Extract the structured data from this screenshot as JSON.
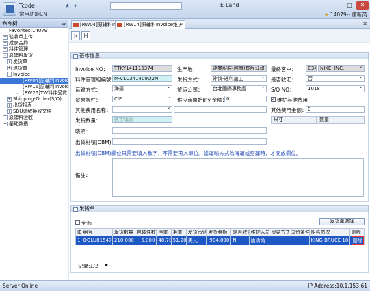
{
  "titlebar": {
    "app_title": "Tcode",
    "app_subtitle": "常用功能CN",
    "tcode_placeholder": "",
    "window_title": "E-Land",
    "user_info": "14079-- 唐昕芮"
  },
  "nav": {
    "header": "命令树",
    "items": [
      {
        "label": "Favorites:14079",
        "expander": "",
        "selected": false
      },
      {
        "label": "验收单上传",
        "expander": "+",
        "selected": false
      },
      {
        "label": "成衣合约",
        "expander": "+",
        "selected": false
      },
      {
        "label": "料件管理",
        "expander": "+",
        "selected": false
      },
      {
        "label": "原辅料发货",
        "expander": "-",
        "selected": false
      },
      {
        "label": "发货单",
        "expander": "+",
        "selected": false
      },
      {
        "label": "退货单",
        "expander": "+",
        "selected": false
      },
      {
        "label": "Invoice",
        "expander": "-",
        "selected": false
      },
      {
        "label": "[RW04]原辅料Invoice",
        "expander": "",
        "selected": true
      },
      {
        "label": "[RW16]原辅料Invoice查询",
        "expander": "",
        "selected": false
      },
      {
        "label": "[RW26]TW料件受貨單檢",
        "expander": "",
        "selected": false
      },
      {
        "label": "Shipping-Order(S/O)",
        "expander": "+",
        "selected": false
      },
      {
        "label": "出货报表",
        "expander": "+",
        "selected": false
      },
      {
        "label": "SBU请醒接收文件",
        "expander": "+",
        "selected": false
      },
      {
        "label": "原辅料验收",
        "expander": "+",
        "selected": false
      },
      {
        "label": "基础数据",
        "expander": "+",
        "selected": false
      }
    ]
  },
  "tabs": [
    {
      "label": "[RW04]原辅料Invoice",
      "active": false
    },
    {
      "label": "[RW14]原辅料Invoice维护",
      "active": true
    }
  ],
  "toolbar": {
    "buttons": [
      "×",
      "H"
    ]
  },
  "basic": {
    "header": "基本信息",
    "invoice_no_label": "Invoice NO：",
    "invoice_no": "TTKY141115374",
    "factory_label": "生产地：",
    "factory_value": "達業服裝(越南)有限公司",
    "final_customer_label": "最終客户：",
    "final_customer_code": "C34",
    "final_customer_name": "NIKE, INC.",
    "material_no_label": "料件管理組編號：",
    "material_no": "M-V1C341409Q2N",
    "ship_method_label": "发货方式：",
    "ship_method": "外销-进料加工",
    "is_received_label": "是否收汇：",
    "is_received": "否",
    "transport_label": "运输方式：",
    "transport": "海運",
    "forwarder_label": "货运公司：",
    "forwarder": "台北國際專務處",
    "so_no_label": "S/O NO：",
    "so_no": "1018",
    "trade_terms_label": "贸易条件：",
    "trade_terms": "CIF",
    "supplier_inv_label": "供应商原始Inv.金额：",
    "supplier_inv": "0",
    "maintain_other_label": "维护其他费用",
    "other_fee_name_label": "其他费用名称：",
    "other_fee_name": "",
    "other_fee_amount_label": "其他费用金额：",
    "other_fee_amount": "0",
    "ship_qty_label": "发货数量：",
    "ship_qty_placeholder": "數字填寫",
    "size_col": "尺寸",
    "qty_col": "数量",
    "memo_label": "嘜頭：",
    "memo": "",
    "cbm_label": "出貨材積(CBM)：",
    "cbm": "",
    "cbm_note": "出貨材積(CBM)欄位只需要填入數字，不需要帶入單位。當運輸方式為海運或空運時，才開放欄位。",
    "remark_label": "備註："
  },
  "shipping": {
    "header": "发货单",
    "select_all_label": "全选",
    "add_button": "发货单选择",
    "columns": [
      "ID",
      "组号",
      "发货数量",
      "包装件数",
      "净重",
      "毛重",
      "发货币别",
      "发货金额",
      "是否收汇",
      "维护人员",
      "贸易方式",
      "国贸条件",
      "船名航次",
      "删除"
    ],
    "rows": [
      {
        "id": "18",
        "group": "OOLU8154714",
        "qty": "210.000",
        "packs": "5.000",
        "net": "48.700",
        "gross": "51.200",
        "currency": "美元",
        "amount": "904.890",
        "received": "N",
        "maintainer": "唐昕芮",
        "trade": "",
        "terms": "",
        "vessel": "KING BRUCE 105S",
        "delete": "删除"
      }
    ],
    "pager": "记录:1/2"
  },
  "status": {
    "left": "Server Online",
    "right": "IP Address:10.1.153.61"
  }
}
